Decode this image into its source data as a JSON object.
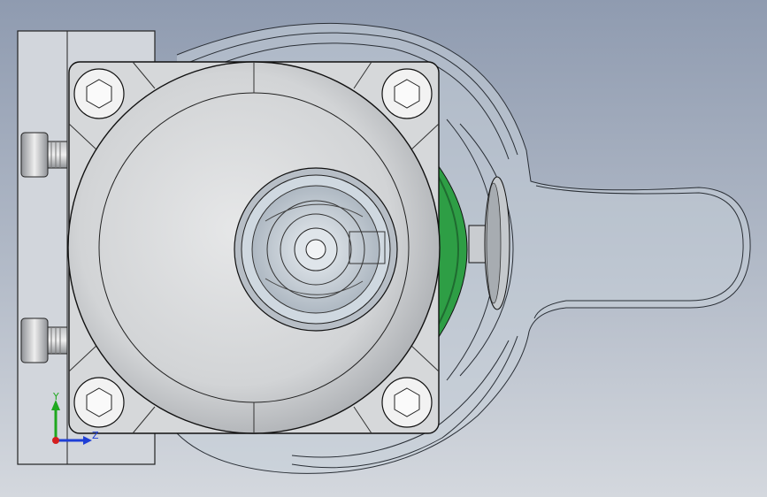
{
  "viewport": {
    "background_top": "#8f9bb0",
    "background_bottom": "#d4d8de"
  },
  "colors": {
    "part_fill": "#d6d8da",
    "part_fill_dark": "#b9bcc0",
    "part_edge": "#1a1a1a",
    "transparent_housing": "#c9d3dc",
    "green_component": "#2e9e45",
    "green_dark": "#1f6b30",
    "axis_y": "#1fa81f",
    "axis_z": "#1f3fd6",
    "axis_x": "#d41f1f"
  },
  "triad": {
    "y_label": "Y",
    "z_label": "Z"
  },
  "icons": {
    "bolt_head": "hex-socket-bolt-icon",
    "screw_side": "socket-cap-screw-icon",
    "triad": "coordinate-triad-icon"
  }
}
